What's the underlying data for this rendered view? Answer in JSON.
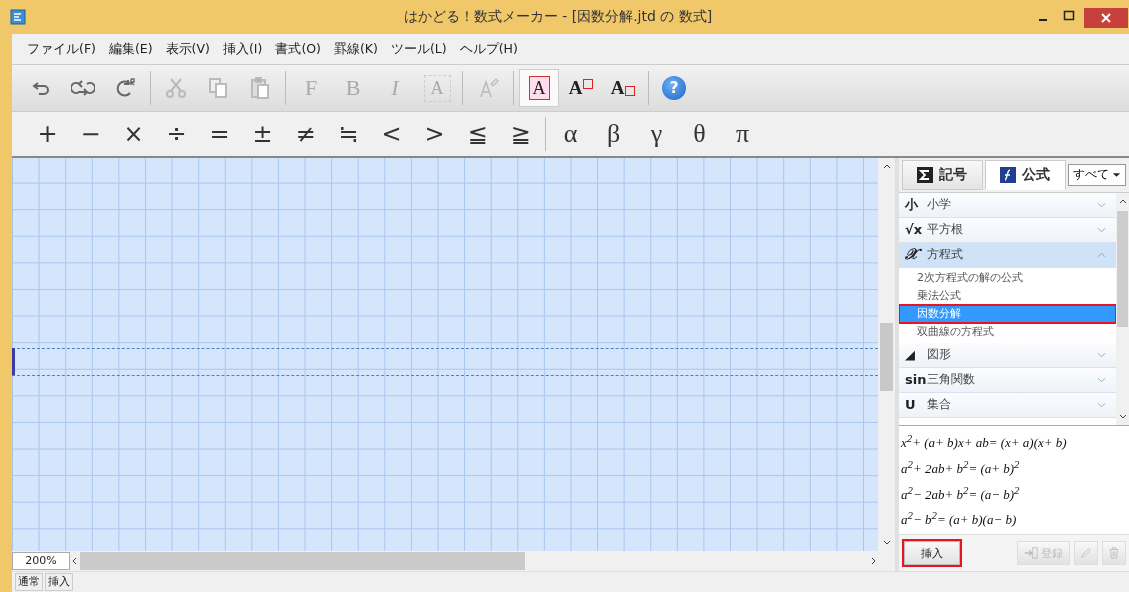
{
  "window": {
    "title": "はかどる！数式メーカー - [因数分解.jtd の 数式]"
  },
  "menu": [
    "ファイル(F)",
    "編集(E)",
    "表示(V)",
    "挿入(I)",
    "書式(O)",
    "罫線(K)",
    "ツール(L)",
    "ヘルプ(H)"
  ],
  "format_toolbar": [
    {
      "buttons": [
        {
          "kind": "icon",
          "disabled": false,
          "selected": false
        },
        {
          "kind": "icon",
          "disabled": false,
          "selected": false
        },
        {
          "kind": "icon",
          "disabled": false,
          "selected": false
        }
      ]
    },
    {
      "buttons": [
        {
          "kind": "icon",
          "disabled": true,
          "selected": false
        },
        {
          "kind": "icon",
          "disabled": true,
          "selected": false
        },
        {
          "kind": "icon",
          "disabled": true,
          "selected": false
        }
      ]
    },
    {
      "buttons": [
        {
          "kind": "letter",
          "label": "F",
          "disabled": true,
          "selected": false
        },
        {
          "kind": "letter",
          "label": "B",
          "disabled": true,
          "selected": false
        },
        {
          "kind": "italic",
          "label": "I",
          "disabled": true,
          "selected": false
        },
        {
          "kind": "crossed",
          "label": "A",
          "disabled": true,
          "selected": false
        }
      ]
    },
    {
      "buttons": [
        {
          "kind": "icon",
          "disabled": true,
          "selected": false
        }
      ]
    },
    {
      "buttons": [
        {
          "kind": "boxed",
          "label": "A",
          "disabled": false,
          "selected": true
        },
        {
          "kind": "sup-box",
          "label": "A",
          "disabled": false,
          "selected": false
        },
        {
          "kind": "sub-box",
          "label": "A",
          "disabled": false,
          "selected": false
        }
      ]
    },
    {
      "buttons": [
        {
          "kind": "help",
          "label": "?",
          "disabled": false,
          "selected": false
        }
      ]
    }
  ],
  "symbol_toolbar": [
    {
      "symbols": [
        "+",
        "−",
        "×",
        "÷",
        "=",
        "±",
        "≠",
        "≒",
        "<",
        ">",
        "≦",
        "≧"
      ]
    },
    {
      "symbols": [
        "α",
        "β",
        "γ",
        "θ",
        "π"
      ]
    }
  ],
  "editor": {
    "zoom": "200%"
  },
  "panel": {
    "tabs": [
      {
        "label": "記号",
        "selected": false
      },
      {
        "label": "公式",
        "selected": true
      }
    ],
    "filter": "すべて",
    "categories": [
      {
        "symbol": "小",
        "label": "小学",
        "expanded": false
      },
      {
        "symbol": "√x",
        "label": "平方根",
        "expanded": false
      },
      {
        "symbol": "𝒳",
        "label": "方程式",
        "expanded": true,
        "children": [
          {
            "label": "2次方程式の解の公式",
            "selected": false,
            "annotated": false
          },
          {
            "label": "乗法公式",
            "selected": false,
            "annotated": false
          },
          {
            "label": "因数分解",
            "selected": true,
            "annotated": true
          },
          {
            "label": "双曲線の方程式",
            "selected": false,
            "annotated": false
          }
        ]
      },
      {
        "symbol": "◢",
        "label": "図形",
        "expanded": false
      },
      {
        "symbol": "sin",
        "label": "三角関数",
        "expanded": false
      },
      {
        "symbol": "U",
        "label": "集合",
        "expanded": false
      }
    ],
    "formulas": [
      "x$^{2}$+ (a+ b)x+ ab= (x+ a)(x+ b)",
      "a$^{2}$+ 2ab+ b$^{2}$= (a+ b)$^{2}$",
      "a$^{2}$− 2ab+ b$^{2}$= (a− b)$^{2}$",
      "a$^{2}$− b$^{2}$= (a+ b)(a− b)"
    ],
    "insert_button": {
      "label": "挿入",
      "annotated": true
    },
    "register_button": {
      "label": "登録",
      "disabled": true
    },
    "edit_button": {
      "disabled": true
    },
    "delete_button": {
      "disabled": true
    }
  },
  "status_bar": [
    "通常",
    "挿入"
  ]
}
